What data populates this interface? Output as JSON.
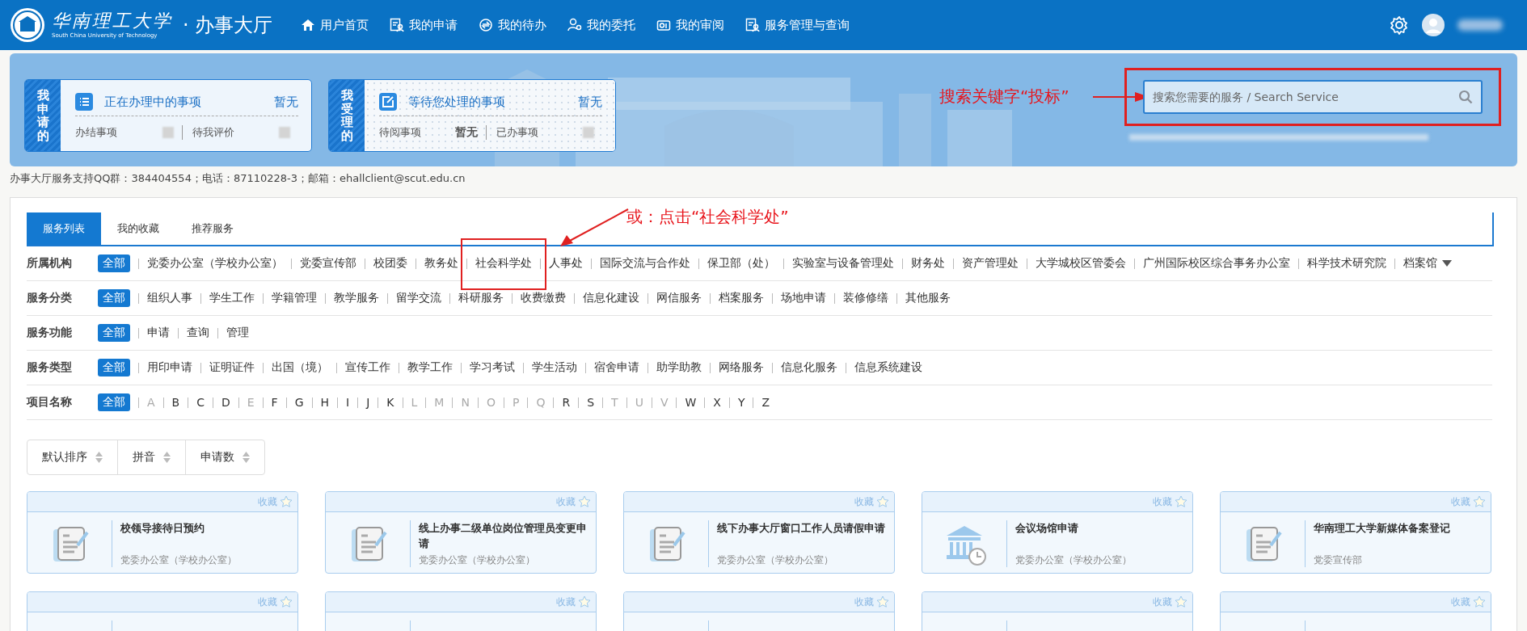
{
  "header": {
    "logo_text": "华南理工大学",
    "logo_subtitle": "South China University of Technology",
    "app_title": "· 办事大厅",
    "nav": [
      {
        "label": "用户首页",
        "kind": "home"
      },
      {
        "label": "我的申请",
        "kind": "doc"
      },
      {
        "label": "我的待办",
        "kind": "cycle"
      },
      {
        "label": "我的委托",
        "kind": "person"
      },
      {
        "label": "我的审阅",
        "kind": "review"
      },
      {
        "label": "服务管理与查询",
        "kind": "doc"
      }
    ]
  },
  "summary": [
    {
      "side": "我申请的",
      "title": "正在办理中的事项",
      "kind": "list",
      "status": "暂无",
      "items": [
        {
          "label": "办结事项"
        },
        {
          "label": "待我评价"
        }
      ]
    },
    {
      "side": "我受理的",
      "title": "等待您处理的事项",
      "kind": "edit",
      "status": "暂无",
      "items": [
        {
          "label": "待阅事项",
          "value": "暂无"
        },
        {
          "label": "已办事项"
        }
      ]
    }
  ],
  "search": {
    "placeholder": "搜索您需要的服务 / Search Service"
  },
  "contact": "办事大厅服务支持QQ群：384404554；电话：87110228-3；邮箱：ehallclient@scut.edu.cn",
  "annotations": [
    {
      "text": "搜索关键字“投标”"
    },
    {
      "text": "或：点击“社会科学处”"
    }
  ],
  "tabs": [
    {
      "label": "服务列表",
      "selected": true
    },
    {
      "label": "我的收藏",
      "selected": false
    },
    {
      "label": "推荐服务",
      "selected": false
    }
  ],
  "filters": [
    {
      "label": "所属机构",
      "expandable": true,
      "options": [
        {
          "label": "全部",
          "selected": true
        },
        {
          "label": "党委办公室（学校办公室）",
          "selected": false
        },
        {
          "label": "党委宣传部",
          "selected": false
        },
        {
          "label": "校团委",
          "selected": false
        },
        {
          "label": "教务处",
          "selected": false
        },
        {
          "label": "社会科学处",
          "selected": false,
          "annotated": true
        },
        {
          "label": "人事处",
          "selected": false
        },
        {
          "label": "国际交流与合作处",
          "selected": false
        },
        {
          "label": "保卫部（处）",
          "selected": false
        },
        {
          "label": "实验室与设备管理处",
          "selected": false
        },
        {
          "label": "财务处",
          "selected": false
        },
        {
          "label": "资产管理处",
          "selected": false
        },
        {
          "label": "大学城校区管委会",
          "selected": false
        },
        {
          "label": "广州国际校区综合事务办公室",
          "selected": false
        },
        {
          "label": "科学技术研究院",
          "selected": false
        },
        {
          "label": "档案馆",
          "selected": false
        }
      ]
    },
    {
      "label": "服务分类",
      "expandable": false,
      "options": [
        {
          "label": "全部",
          "selected": true
        },
        {
          "label": "组织人事",
          "selected": false
        },
        {
          "label": "学生工作",
          "selected": false
        },
        {
          "label": "学籍管理",
          "selected": false
        },
        {
          "label": "教学服务",
          "selected": false
        },
        {
          "label": "留学交流",
          "selected": false
        },
        {
          "label": "科研服务",
          "selected": false
        },
        {
          "label": "收费缴费",
          "selected": false
        },
        {
          "label": "信息化建设",
          "selected": false
        },
        {
          "label": "网信服务",
          "selected": false
        },
        {
          "label": "档案服务",
          "selected": false
        },
        {
          "label": "场地申请",
          "selected": false
        },
        {
          "label": "装修修缮",
          "selected": false
        },
        {
          "label": "其他服务",
          "selected": false
        }
      ]
    },
    {
      "label": "服务功能",
      "expandable": false,
      "options": [
        {
          "label": "全部",
          "selected": true
        },
        {
          "label": "申请",
          "selected": false
        },
        {
          "label": "查询",
          "selected": false
        },
        {
          "label": "管理",
          "selected": false
        }
      ]
    },
    {
      "label": "服务类型",
      "expandable": false,
      "options": [
        {
          "label": "全部",
          "selected": true
        },
        {
          "label": "用印申请",
          "selected": false
        },
        {
          "label": "证明证件",
          "selected": false
        },
        {
          "label": "出国（境）",
          "selected": false
        },
        {
          "label": "宣传工作",
          "selected": false
        },
        {
          "label": "教学工作",
          "selected": false
        },
        {
          "label": "学习考试",
          "selected": false
        },
        {
          "label": "学生活动",
          "selected": false
        },
        {
          "label": "宿舍申请",
          "selected": false
        },
        {
          "label": "助学助教",
          "selected": false
        },
        {
          "label": "网络服务",
          "selected": false
        },
        {
          "label": "信息化服务",
          "selected": false
        },
        {
          "label": "信息系统建设",
          "selected": false
        }
      ]
    },
    {
      "label": "项目名称",
      "expandable": false,
      "options": [
        {
          "label": "全部",
          "selected": true
        },
        {
          "label": "A",
          "selected": false,
          "disabled": true
        },
        {
          "label": "B",
          "selected": false,
          "disabled": false
        },
        {
          "label": "C",
          "selected": false,
          "disabled": false
        },
        {
          "label": "D",
          "selected": false,
          "disabled": false
        },
        {
          "label": "E",
          "selected": false,
          "disabled": true
        },
        {
          "label": "F",
          "selected": false,
          "disabled": false
        },
        {
          "label": "G",
          "selected": false,
          "disabled": false
        },
        {
          "label": "H",
          "selected": false,
          "disabled": false
        },
        {
          "label": "I",
          "selected": false,
          "disabled": false
        },
        {
          "label": "J",
          "selected": false,
          "disabled": false
        },
        {
          "label": "K",
          "selected": false,
          "disabled": false
        },
        {
          "label": "L",
          "selected": false,
          "disabled": true
        },
        {
          "label": "M",
          "selected": false,
          "disabled": true
        },
        {
          "label": "N",
          "selected": false,
          "disabled": true
        },
        {
          "label": "O",
          "selected": false,
          "disabled": true
        },
        {
          "label": "P",
          "selected": false,
          "disabled": true
        },
        {
          "label": "Q",
          "selected": false,
          "disabled": true
        },
        {
          "label": "R",
          "selected": false,
          "disabled": false
        },
        {
          "label": "S",
          "selected": false,
          "disabled": false
        },
        {
          "label": "T",
          "selected": false,
          "disabled": true
        },
        {
          "label": "U",
          "selected": false,
          "disabled": true
        },
        {
          "label": "V",
          "selected": false,
          "disabled": true
        },
        {
          "label": "W",
          "selected": false,
          "disabled": false
        },
        {
          "label": "X",
          "selected": false,
          "disabled": false
        },
        {
          "label": "Y",
          "selected": false,
          "disabled": false
        },
        {
          "label": "Z",
          "selected": false,
          "disabled": false
        }
      ]
    }
  ],
  "sort": [
    {
      "label": "默认排序"
    },
    {
      "label": "拼音"
    },
    {
      "label": "申请数"
    }
  ],
  "services": [
    {
      "favorite_label": "收藏",
      "kind": "doc",
      "title": "校领导接待日预约",
      "department": "党委办公室（学校办公室）"
    },
    {
      "favorite_label": "收藏",
      "kind": "doc",
      "title": "线上办事二级单位岗位管理员变更申请",
      "department": "党委办公室（学校办公室）"
    },
    {
      "favorite_label": "收藏",
      "kind": "doc",
      "title": "线下办事大厅窗口工作人员请假申请",
      "department": "党委办公室（学校办公室）"
    },
    {
      "favorite_label": "收藏",
      "kind": "building",
      "title": "会议场馆申请",
      "department": "党委办公室（学校办公室）"
    },
    {
      "favorite_label": "收藏",
      "kind": "doc",
      "title": "华南理工大学新媒体备案登记",
      "department": "党委宣传部"
    },
    {
      "favorite_label": "收藏"
    },
    {
      "favorite_label": "收藏"
    },
    {
      "favorite_label": "收藏"
    },
    {
      "favorite_label": "收藏"
    },
    {
      "favorite_label": "收藏"
    }
  ]
}
